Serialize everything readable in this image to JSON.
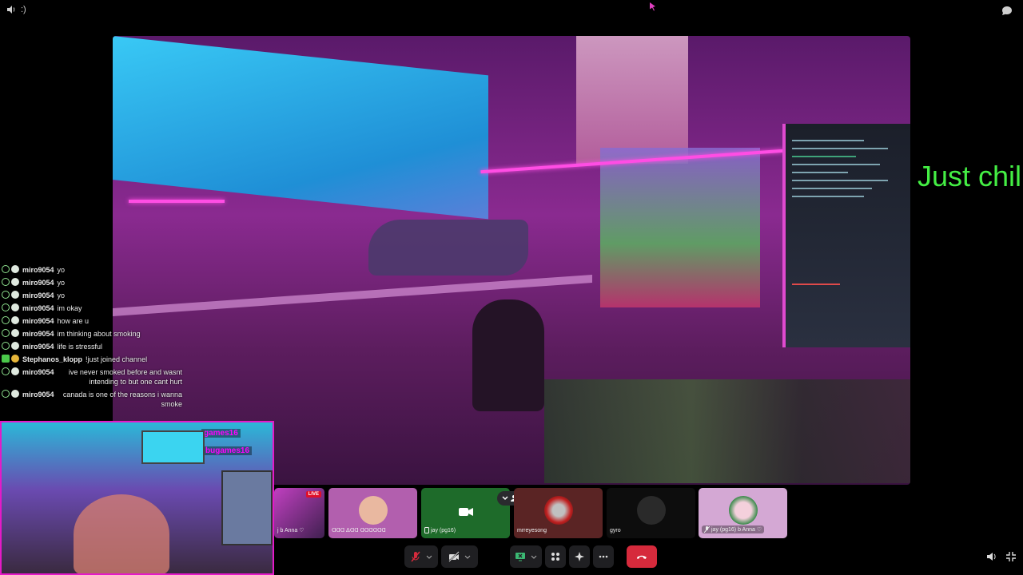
{
  "top": {
    "status_text": ":)",
    "speaker_icon": "volume-icon",
    "chat_icon": "chat-bubble-icon"
  },
  "overlay_text": "Just chil",
  "chat": {
    "messages": [
      {
        "user": "miro9054",
        "text": "yo"
      },
      {
        "user": "miro9054",
        "text": "yo"
      },
      {
        "user": "miro9054",
        "text": "yo"
      },
      {
        "user": "miro9054",
        "text": "im okay"
      },
      {
        "user": "miro9054",
        "text": "how are u"
      },
      {
        "user": "miro9054",
        "text": "im thinking about smoking"
      },
      {
        "user": "miro9054",
        "text": "life is stressful"
      },
      {
        "user": "Stephanos_klopp",
        "text": "!just joined channel"
      },
      {
        "user": "miro9054",
        "text": "ive never smoked before and wasnt intending to but one cant hurt"
      },
      {
        "user": "miro9054",
        "text": "canada is one of the reasons i wanna smoke"
      }
    ]
  },
  "pip": {
    "overlay_1": "games16",
    "overlay_2": "bugames16"
  },
  "tiles": [
    {
      "label": "j b Anna ♡",
      "live": "LIVE"
    },
    {
      "label": "ꓷꓷꓷ ᐃꓷꓷ ꓷꓷꓷꓷꓷꓷ"
    },
    {
      "label": "jay (pg16)"
    },
    {
      "label": "mrreyesong"
    },
    {
      "label": "gyro"
    },
    {
      "label": "jay (pg16) b Anna ♡"
    }
  ],
  "colors": {
    "accent_green": "#44ee44",
    "pip_border": "#e41ac8",
    "end_call": "#d62a3c"
  },
  "controls": [
    {
      "name": "mute-mic",
      "icon": "mic-off-icon"
    },
    {
      "name": "camera-off",
      "icon": "video-off-icon"
    },
    {
      "name": "share-screen",
      "icon": "screen-share-icon"
    },
    {
      "name": "activities",
      "icon": "apps-icon"
    },
    {
      "name": "reactions",
      "icon": "sparkle-icon"
    },
    {
      "name": "more",
      "icon": "more-icon"
    },
    {
      "name": "end-call",
      "icon": "phone-hangup-icon"
    }
  ]
}
